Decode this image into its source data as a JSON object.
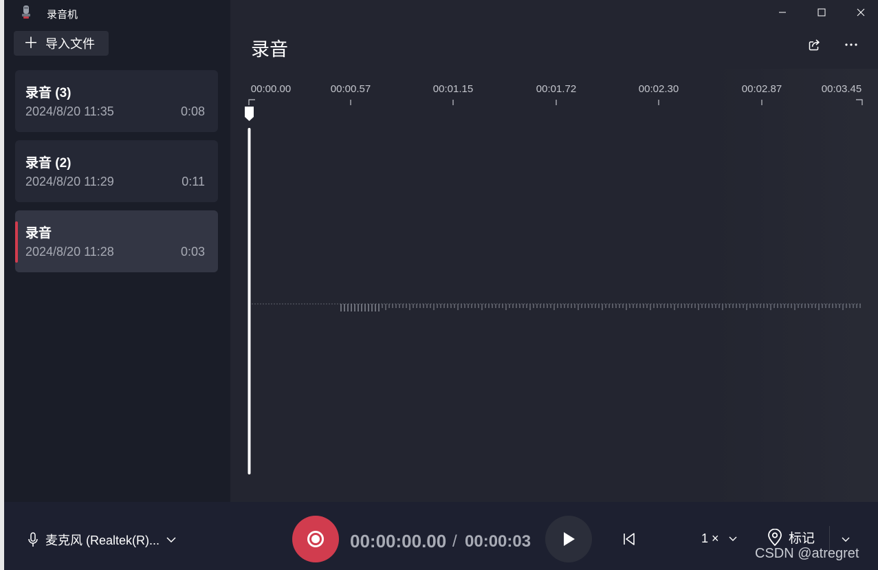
{
  "window": {
    "title": "录音机",
    "controls": [
      "minimize-icon",
      "maximize-icon",
      "close-icon"
    ]
  },
  "sidebar": {
    "import_label": "导入文件",
    "recordings": [
      {
        "name": "录音 (3)",
        "date": "2024/8/20 11:35",
        "duration": "0:08",
        "selected": false
      },
      {
        "name": "录音 (2)",
        "date": "2024/8/20 11:29",
        "duration": "0:11",
        "selected": false
      },
      {
        "name": "录音",
        "date": "2024/8/20 11:28",
        "duration": "0:03",
        "selected": true
      }
    ]
  },
  "main": {
    "title": "录音",
    "header_icons": [
      "share-icon",
      "more-icon"
    ],
    "timeline": {
      "ticks": [
        "00:00.00",
        "00:00.57",
        "00:01.15",
        "00:01.72",
        "00:02.30",
        "00:02.87",
        "00:03.45"
      ],
      "playhead_position": 0.0
    }
  },
  "bottom": {
    "microphone": "麦克风 (Realtek(R)...",
    "current_time": "00:00:00.00",
    "separator": "/",
    "total_time": "00:00:03",
    "speed": "1 ×",
    "mark_label": "标记"
  },
  "watermark": "CSDN @atregret",
  "colors": {
    "accent_red": "#d13c4e",
    "sidebar_bg": "#1a1d28",
    "main_bg": "#232530",
    "card_bg": "#252835",
    "card_selected_bg": "#333644"
  }
}
